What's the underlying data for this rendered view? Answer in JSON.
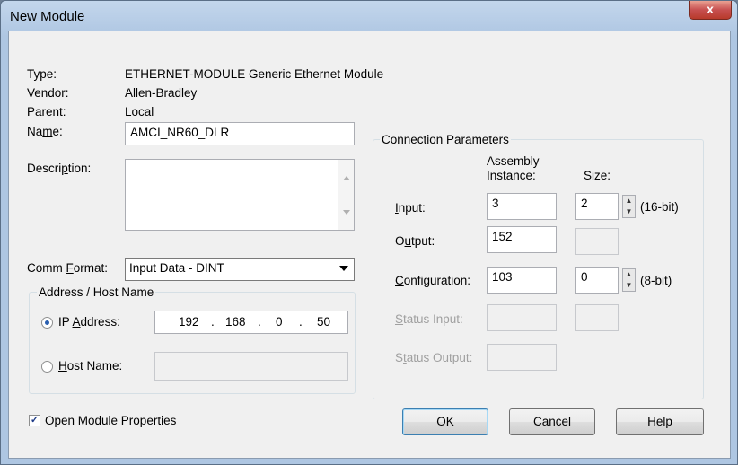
{
  "window": {
    "title": "New Module",
    "close_glyph": "x"
  },
  "info": {
    "type_label": "Type:",
    "type_value": "ETHERNET-MODULE Generic Ethernet Module",
    "vendor_label": "Vendor:",
    "vendor_value": "Allen-Bradley",
    "parent_label": "Parent:",
    "parent_value": "Local"
  },
  "name": {
    "label_pre": "Na",
    "label_key": "m",
    "label_post": "e:",
    "value": "AMCI_NR60_DLR"
  },
  "description": {
    "label_pre": "Descri",
    "label_key": "p",
    "label_post": "tion:",
    "value": ""
  },
  "comm_format": {
    "label_pre": "Comm ",
    "label_key": "F",
    "label_post": "ormat:",
    "value": "Input Data - DINT"
  },
  "address": {
    "group_label": "Address / Host Name",
    "ip_label_pre": "IP ",
    "ip_label_key": "A",
    "ip_label_post": "ddress:",
    "ip_octets": [
      "192",
      "168",
      "0",
      "50"
    ],
    "ip_dot": ".",
    "host_label_key": "H",
    "host_label_post": "ost Name:",
    "host_value": "",
    "selected": "ip"
  },
  "connection": {
    "group_label": "Connection Parameters",
    "col_assembly_1": "Assembly",
    "col_assembly_2": "Instance:",
    "col_size": "Size:",
    "input": {
      "label_key": "I",
      "label_post": "nput:",
      "instance": "3",
      "size": "2",
      "unit": "(16-bit)"
    },
    "output": {
      "label_pre": "O",
      "label_key": "u",
      "label_post": "tput:",
      "instance": "152",
      "size": ""
    },
    "configuration": {
      "label_key": "C",
      "label_post": "onfiguration:",
      "instance": "103",
      "size": "0",
      "unit": "(8-bit)"
    },
    "status_input": {
      "label_key": "S",
      "label_post": "tatus Input:"
    },
    "status_output": {
      "label_pre": "S",
      "label_key": "t",
      "label_post": "atus Output:"
    }
  },
  "open_props": {
    "label": "Open Module Properties",
    "checked": true,
    "check_glyph": "✓"
  },
  "buttons": {
    "ok": "OK",
    "cancel": "Cancel",
    "help": "Help"
  },
  "colors": {
    "title_bar": "#b9cfe9",
    "close_button": "#c75050",
    "dialog_bg": "#f0f0f0",
    "radio_dot": "#2a5fb0"
  }
}
